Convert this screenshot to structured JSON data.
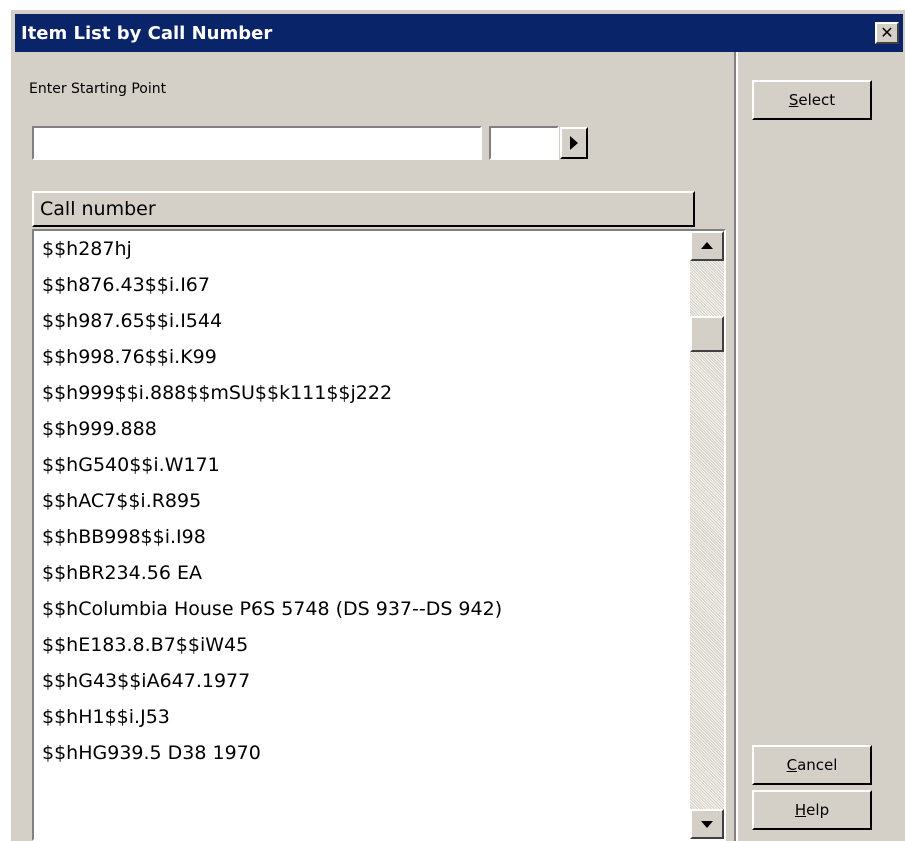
{
  "window": {
    "title": "Item List by Call Number",
    "close_glyph": "✕"
  },
  "search": {
    "label": "Enter Starting Point",
    "value": "",
    "secondary_value": ""
  },
  "list": {
    "column_header": "Call number",
    "items": [
      "$$h287hj",
      "$$h876.43$$i.I67",
      "$$h987.65$$i.I544",
      "$$h998.76$$i.K99",
      "$$h999$$i.888$$mSU$$k111$$j222",
      "$$h999.888",
      "$$hG540$$i.W171",
      "$$hAC7$$i.R895",
      "$$hBB998$$i.I98",
      "$$hBR234.56 EA",
      "$$hColumbia House P6S 5748 (DS 937--DS 942)",
      "$$hE183.8.B7$$iW45",
      "$$hG43$$iA647.1977",
      "$$hH1$$i.J53",
      "$$hHG939.5 D38 1970"
    ]
  },
  "buttons": {
    "select": {
      "mnemonic": "S",
      "rest": "elect"
    },
    "cancel": {
      "mnemonic": "C",
      "rest": "ancel"
    },
    "help": {
      "mnemonic": "H",
      "rest": "elp"
    }
  },
  "icons": {
    "close": "close-icon",
    "go": "play-right-icon",
    "scroll_up": "arrow-up-icon",
    "scroll_down": "arrow-down-icon"
  },
  "colors": {
    "titlebar": "#0a246a",
    "face": "#d4d0c8"
  }
}
